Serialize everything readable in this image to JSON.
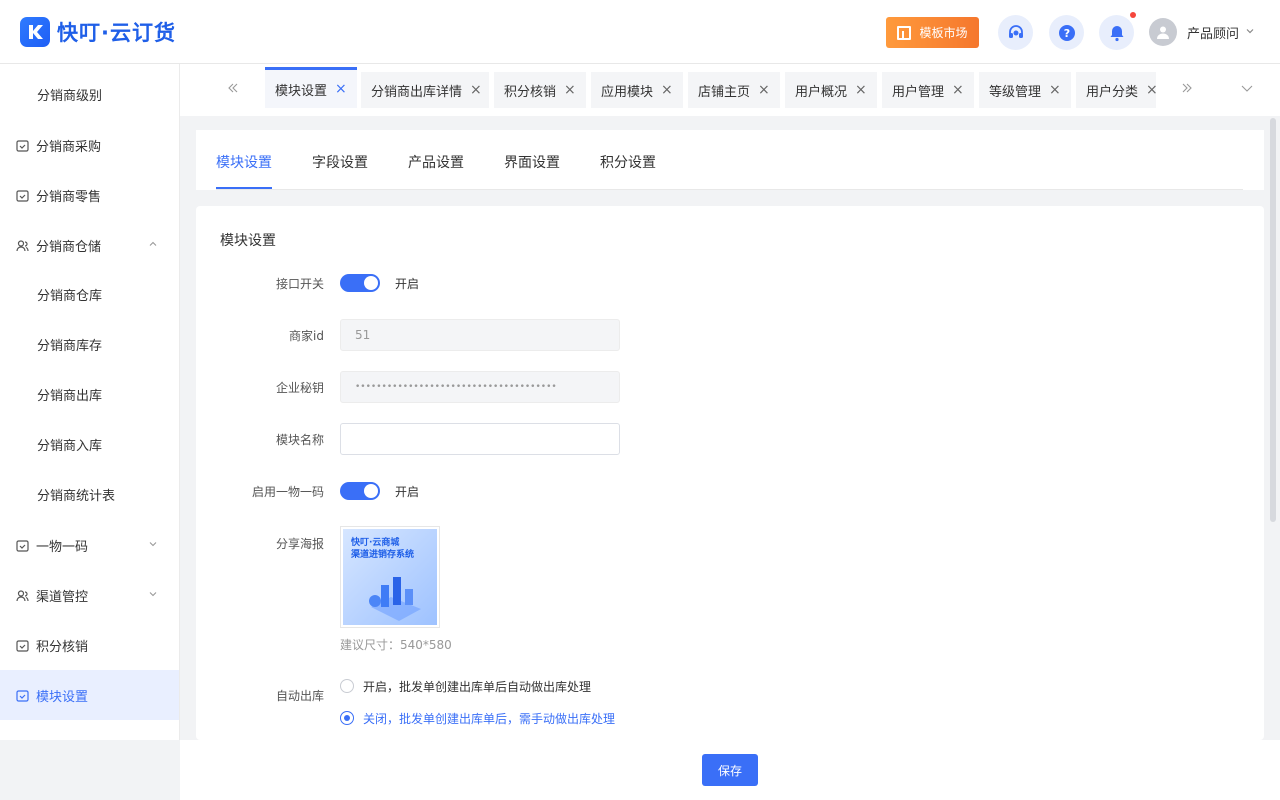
{
  "header": {
    "logo_text": "快叮·云订货",
    "template_market_label": "模板市场",
    "user_name": "产品顾问",
    "colors": {
      "brand": "#1f5fe8",
      "accent": "#3a6ff7",
      "template_btn": "#f5772d",
      "notification_dot": "#f5463c"
    }
  },
  "sidebar": {
    "items": [
      {
        "label": "分销商级别"
      },
      {
        "label": "分销商采购"
      },
      {
        "label": "分销商零售"
      },
      {
        "label": "分销商仓储"
      },
      {
        "label": "分销商仓库"
      },
      {
        "label": "分销商库存"
      },
      {
        "label": "分销商出库"
      },
      {
        "label": "分销商入库"
      },
      {
        "label": "分销商统计表"
      },
      {
        "label": "一物一码"
      },
      {
        "label": "渠道管控"
      },
      {
        "label": "积分核销"
      },
      {
        "label": "模块设置"
      }
    ]
  },
  "tabs": {
    "items": [
      {
        "label": "模块设置"
      },
      {
        "label": "分销商出库详情"
      },
      {
        "label": "积分核销"
      },
      {
        "label": "应用模块"
      },
      {
        "label": "店铺主页"
      },
      {
        "label": "用户概况"
      },
      {
        "label": "用户管理"
      },
      {
        "label": "等级管理"
      },
      {
        "label": "用户分类"
      }
    ],
    "active": "模块设置"
  },
  "subtabs": {
    "items": [
      {
        "label": "模块设置"
      },
      {
        "label": "字段设置"
      },
      {
        "label": "产品设置"
      },
      {
        "label": "界面设置"
      },
      {
        "label": "积分设置"
      }
    ],
    "active": "模块设置"
  },
  "form": {
    "section_title": "模块设置",
    "api_switch": {
      "label": "接口开关",
      "state_text": "开启",
      "on": true
    },
    "merchant_id": {
      "label": "商家id",
      "value": "51"
    },
    "secret": {
      "label": "企业秘钥",
      "value": "••••••••••••••••••••••••••••••••••••••"
    },
    "module_name": {
      "label": "模块名称",
      "value": ""
    },
    "code_switch": {
      "label": "启用一物一码",
      "state_text": "开启",
      "on": true
    },
    "poster": {
      "label": "分享海报",
      "image_title_line1": "快叮·云商城",
      "image_title_line2": "渠道进销存系统",
      "hint": "建议尺寸：540*580"
    },
    "auto_out": {
      "label": "自动出库",
      "options": [
        {
          "label": "开启，批发单创建出库单后自动做出库处理",
          "selected": false
        },
        {
          "label": "关闭，批发单创建出库单后，需手动做出库处理",
          "selected": true
        }
      ]
    }
  },
  "footer": {
    "save_label": "保存"
  }
}
